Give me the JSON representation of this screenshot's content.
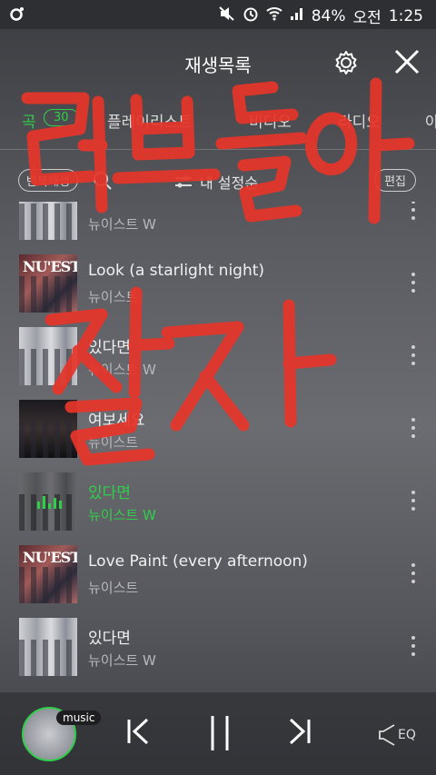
{
  "status_bar": {
    "battery": "84%",
    "ampm": "오전",
    "time": "1:25"
  },
  "header": {
    "title": "재생목록"
  },
  "tabs": [
    {
      "label": "곡",
      "badge": "30"
    },
    {
      "label": "플레이리스트"
    },
    {
      "label": "비디오"
    },
    {
      "label": "라디오"
    },
    {
      "label": "아"
    }
  ],
  "toolbar": {
    "repeat_label": "반복재생",
    "sort_label": "내 설정순",
    "edit_label": "편집"
  },
  "songs": [
    {
      "title": "",
      "artist": "뉴이스트 W"
    },
    {
      "title": "Look (a starlight night)",
      "artist": "뉴이스트"
    },
    {
      "title": "있다면",
      "artist": "뉴이스트 W"
    },
    {
      "title": "여보세요",
      "artist": "뉴이스트"
    },
    {
      "title": "있다면",
      "artist": "뉴이스트 W"
    },
    {
      "title": "Love Paint (every afternoon)",
      "artist": "뉴이스트"
    },
    {
      "title": "있다면",
      "artist": "뉴이스트 W"
    }
  ],
  "album_text": {
    "nuest": "NU'EST"
  },
  "player": {
    "badge": "music",
    "eq_label": "EQ"
  },
  "annotation": {
    "line1": "러브들아",
    "line2": "잘자"
  },
  "colors": {
    "accent": "#2fcf4a",
    "scribble": "#e8352a"
  }
}
